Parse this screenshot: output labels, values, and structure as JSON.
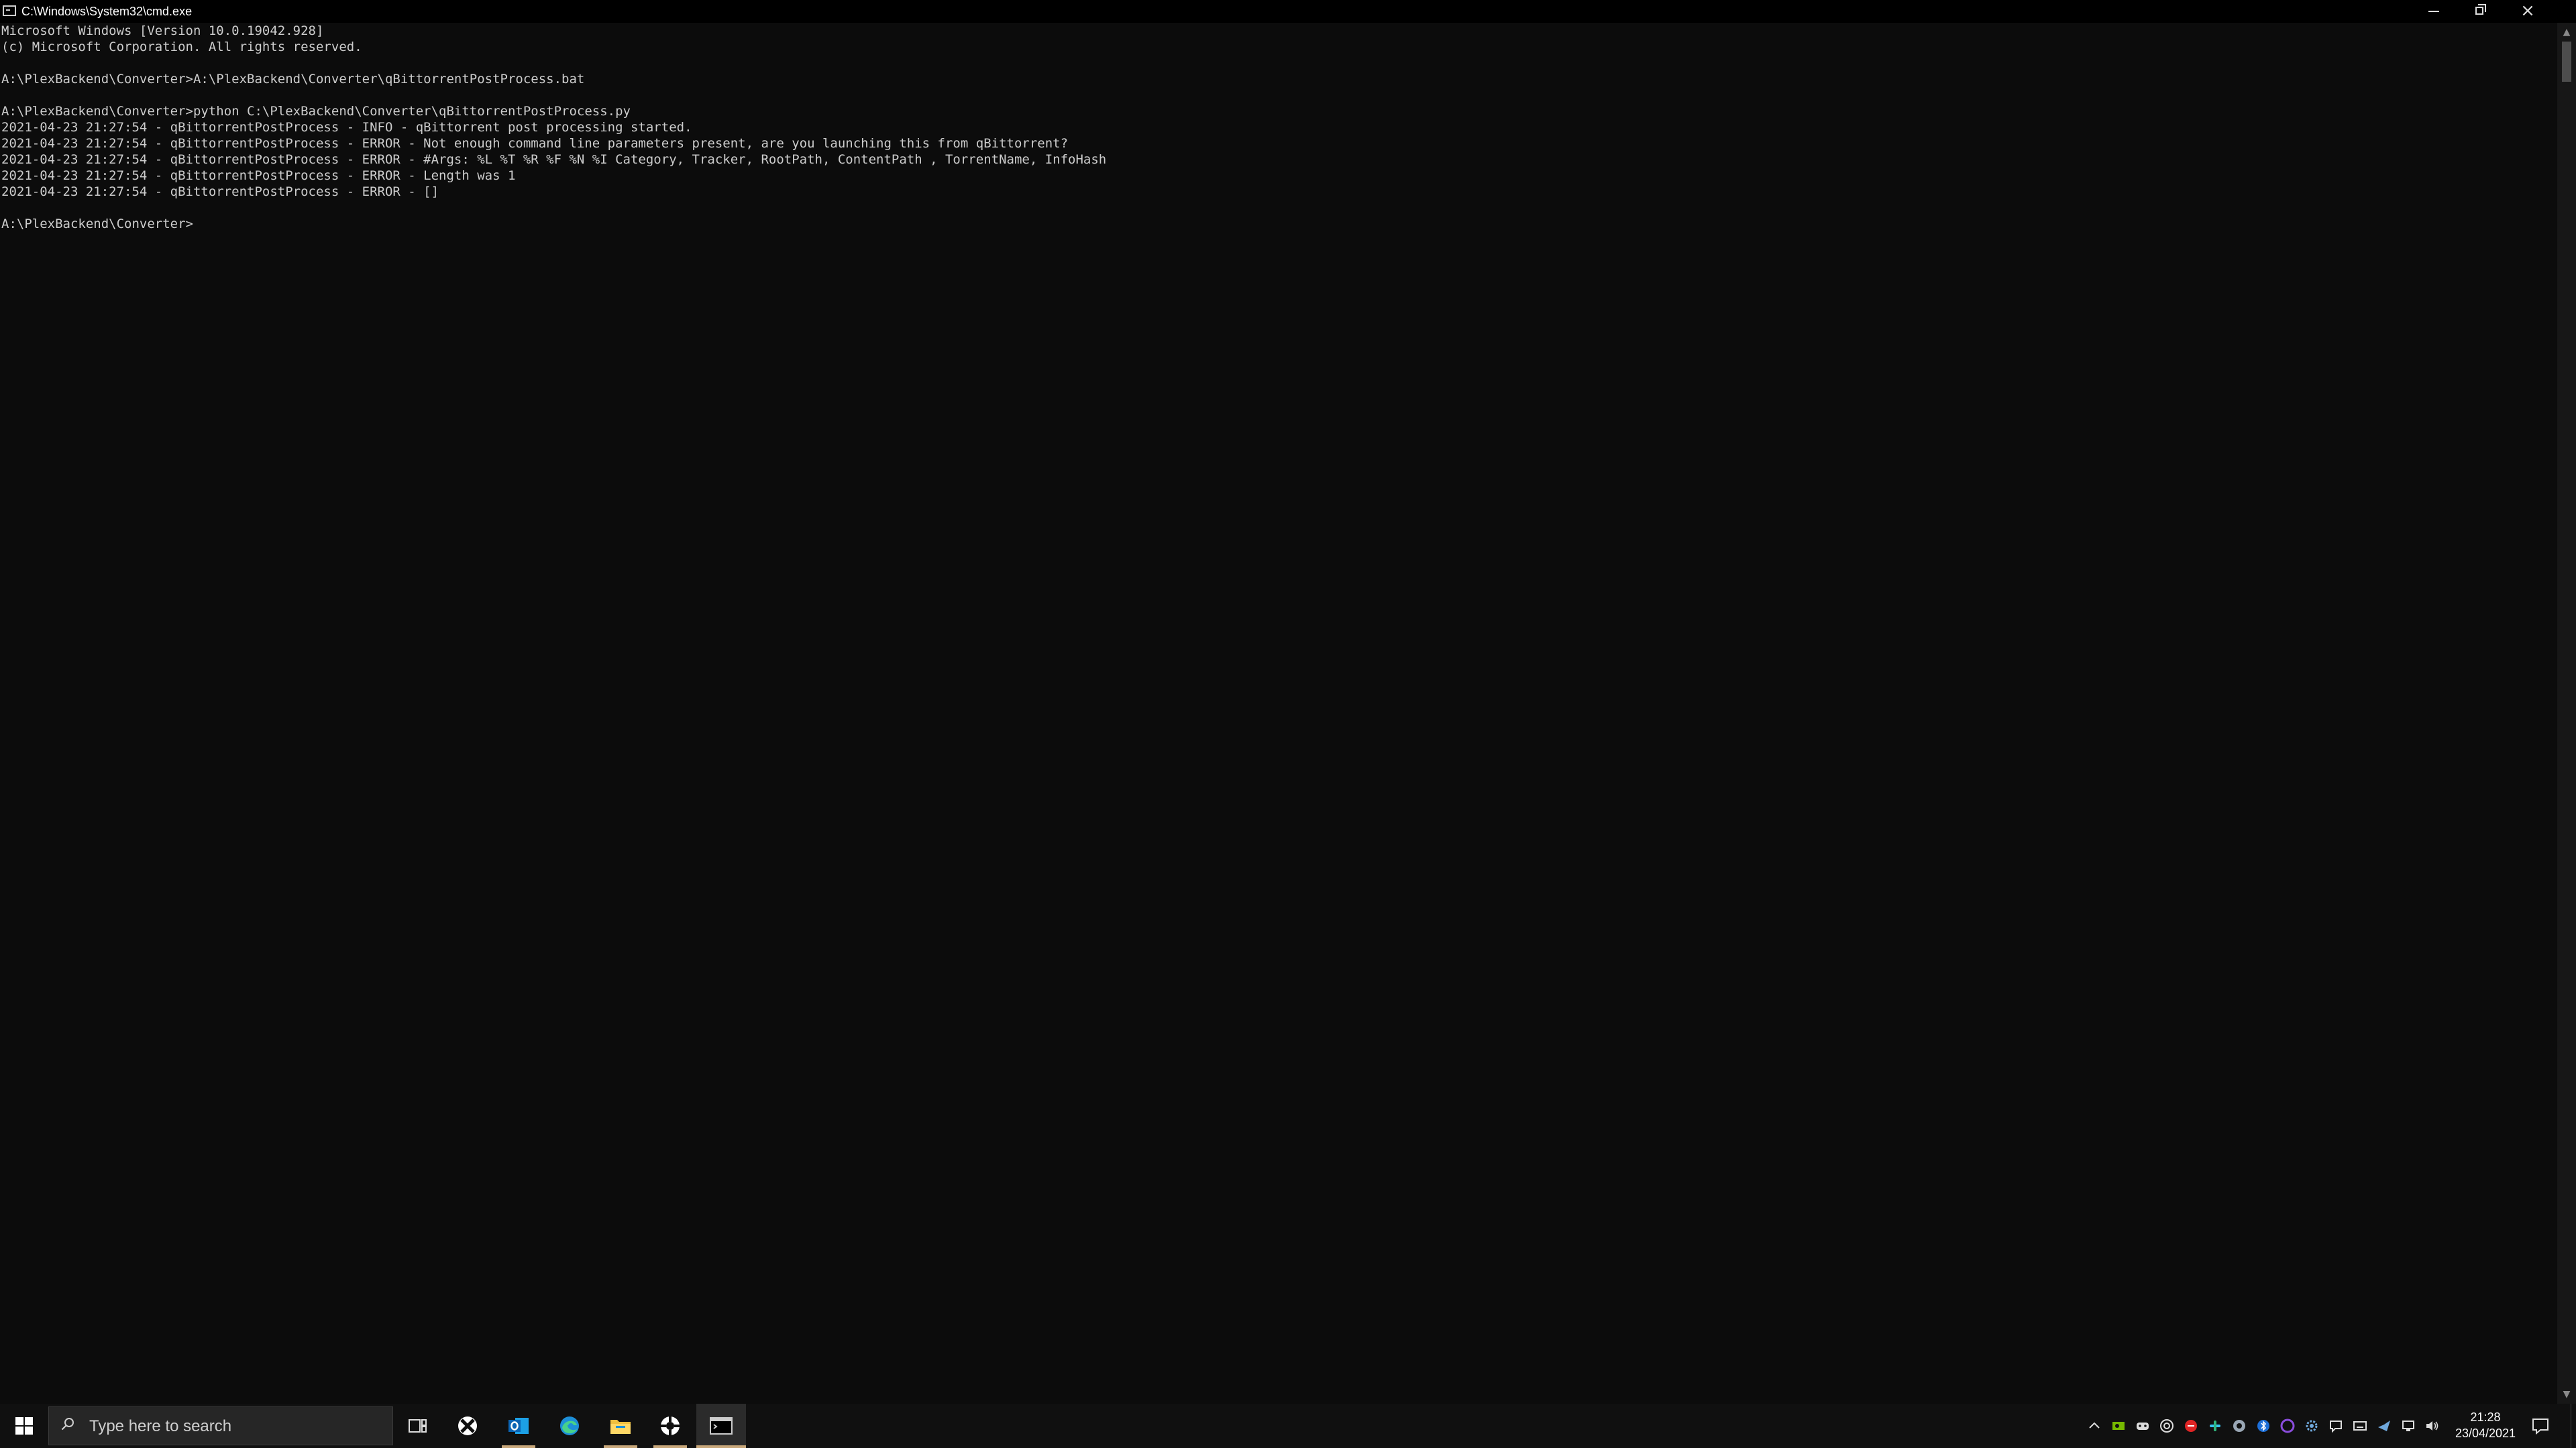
{
  "window": {
    "title": "C:\\Windows\\System32\\cmd.exe",
    "close_glyph": "×"
  },
  "console": {
    "lines": [
      "Microsoft Windows [Version 10.0.19042.928]",
      "(c) Microsoft Corporation. All rights reserved.",
      "",
      "A:\\PlexBackend\\Converter>A:\\PlexBackend\\Converter\\qBittorrentPostProcess.bat",
      "",
      "A:\\PlexBackend\\Converter>python C:\\PlexBackend\\Converter\\qBittorrentPostProcess.py",
      "2021-04-23 21:27:54 - qBittorrentPostProcess - INFO - qBittorrent post processing started.",
      "2021-04-23 21:27:54 - qBittorrentPostProcess - ERROR - Not enough command line parameters present, are you launching this from qBittorrent?",
      "2021-04-23 21:27:54 - qBittorrentPostProcess - ERROR - #Args: %L %T %R %F %N %I Category, Tracker, RootPath, ContentPath , TorrentName, InfoHash",
      "2021-04-23 21:27:54 - qBittorrentPostProcess - ERROR - Length was 1",
      "2021-04-23 21:27:54 - qBittorrentPostProcess - ERROR - []",
      "",
      "A:\\PlexBackend\\Converter>"
    ]
  },
  "scrollbar": {
    "up_glyph": "▲",
    "down_glyph": "▼"
  },
  "taskbar": {
    "search_placeholder": "Type here to search",
    "apps": [
      "start-icon",
      "task-view-icon",
      "xbox-icon",
      "outlook-icon",
      "edge-icon",
      "file-explorer-icon",
      "lifebuoy-icon",
      "cmd-icon"
    ],
    "tray_icons": [
      "chevron-up-icon",
      "nvidia-icon",
      "gamepad-icon",
      "steam-like-icon",
      "red-app-icon",
      "slack-icon",
      "generic-app-icon",
      "bluetooth-like-icon",
      "purple-app-icon",
      "settings-icon",
      "chat-icon",
      "keyboard-icon",
      "steam-icon",
      "network-icon",
      "volume-icon"
    ],
    "clock_time": "21:28",
    "clock_date": "23/04/2021"
  },
  "colors": {
    "console_bg": "#0c0c0c",
    "console_fg": "#cccccc",
    "taskbar_bg": "#101010",
    "accent_running": "#c8a77a"
  }
}
